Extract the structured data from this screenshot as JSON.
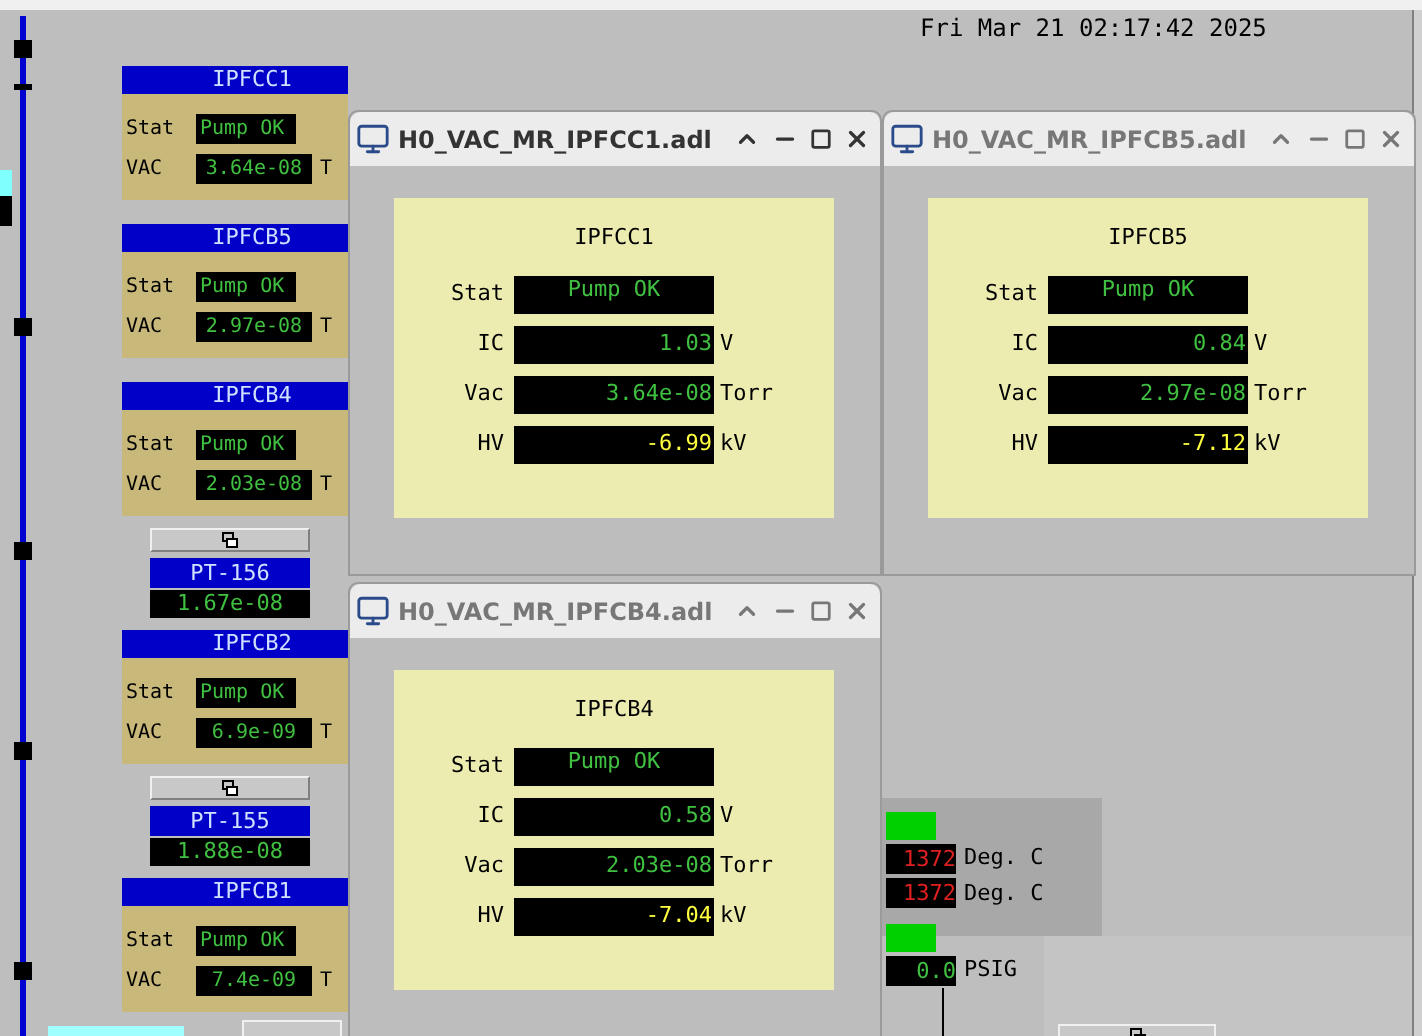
{
  "clock": "Fri Mar 21 02:17:42 2025",
  "devices": [
    {
      "kind": "pump",
      "title": "IPFCC1",
      "stat_label": "Stat",
      "stat": "Pump OK",
      "vac_label": "VAC",
      "vac": "3.64e-08",
      "unit": "T"
    },
    {
      "kind": "pump",
      "title": "IPFCB5",
      "stat_label": "Stat",
      "stat": "Pump OK",
      "vac_label": "VAC",
      "vac": "2.97e-08",
      "unit": "T"
    },
    {
      "kind": "pump",
      "title": "IPFCB4",
      "stat_label": "Stat",
      "stat": "Pump OK",
      "vac_label": "VAC",
      "vac": "2.03e-08",
      "unit": "T"
    },
    {
      "kind": "gauge",
      "title": "PT-156",
      "vac": "1.67e-08"
    },
    {
      "kind": "pump",
      "title": "IPFCB2",
      "stat_label": "Stat",
      "stat": "Pump OK",
      "vac_label": "VAC",
      "vac": "6.9e-09",
      "unit": "T"
    },
    {
      "kind": "gauge",
      "title": "PT-155",
      "vac": "1.88e-08"
    },
    {
      "kind": "pump",
      "title": "IPFCB1",
      "stat_label": "Stat",
      "stat": "Pump OK",
      "vac_label": "VAC",
      "vac": "7.4e-09",
      "unit": "T"
    }
  ],
  "readouts": [
    {
      "kind": "indicator",
      "color": "#00d000"
    },
    {
      "kind": "alarm",
      "value": "1372",
      "unit": "Deg. C"
    },
    {
      "kind": "alarm",
      "value": "1372",
      "unit": "Deg. C"
    },
    {
      "kind": "indicator",
      "color": "#00d000"
    },
    {
      "kind": "value",
      "value": "0.0",
      "unit": "PSIG"
    }
  ],
  "windows": [
    {
      "title": "H0_VAC_MR_IPFCC1.adl",
      "panel_title": "IPFCC1",
      "rows": [
        {
          "kind": "status",
          "label": "Stat",
          "value": "Pump OK"
        },
        {
          "kind": "reading",
          "label": "IC",
          "value": "1.03",
          "unit": "V"
        },
        {
          "kind": "reading",
          "label": "Vac",
          "value": "3.64e-08",
          "unit": "Torr"
        },
        {
          "kind": "alert",
          "label": "HV",
          "value": "-6.99",
          "unit": "kV"
        }
      ]
    },
    {
      "title": "H0_VAC_MR_IPFCB5.adl",
      "panel_title": "IPFCB5",
      "rows": [
        {
          "kind": "status",
          "label": "Stat",
          "value": "Pump OK"
        },
        {
          "kind": "reading",
          "label": "IC",
          "value": "0.84",
          "unit": "V"
        },
        {
          "kind": "reading",
          "label": "Vac",
          "value": "2.97e-08",
          "unit": "Torr"
        },
        {
          "kind": "alert",
          "label": "HV",
          "value": "-7.12",
          "unit": "kV"
        }
      ]
    },
    {
      "title": "H0_VAC_MR_IPFCB4.adl",
      "panel_title": "IPFCB4",
      "rows": [
        {
          "kind": "status",
          "label": "Stat",
          "value": "Pump OK"
        },
        {
          "kind": "reading",
          "label": "IC",
          "value": "0.58",
          "unit": "V"
        },
        {
          "kind": "reading",
          "label": "Vac",
          "value": "2.03e-08",
          "unit": "Torr"
        },
        {
          "kind": "alert",
          "label": "HV",
          "value": "-7.04",
          "unit": "kV"
        }
      ]
    }
  ]
}
